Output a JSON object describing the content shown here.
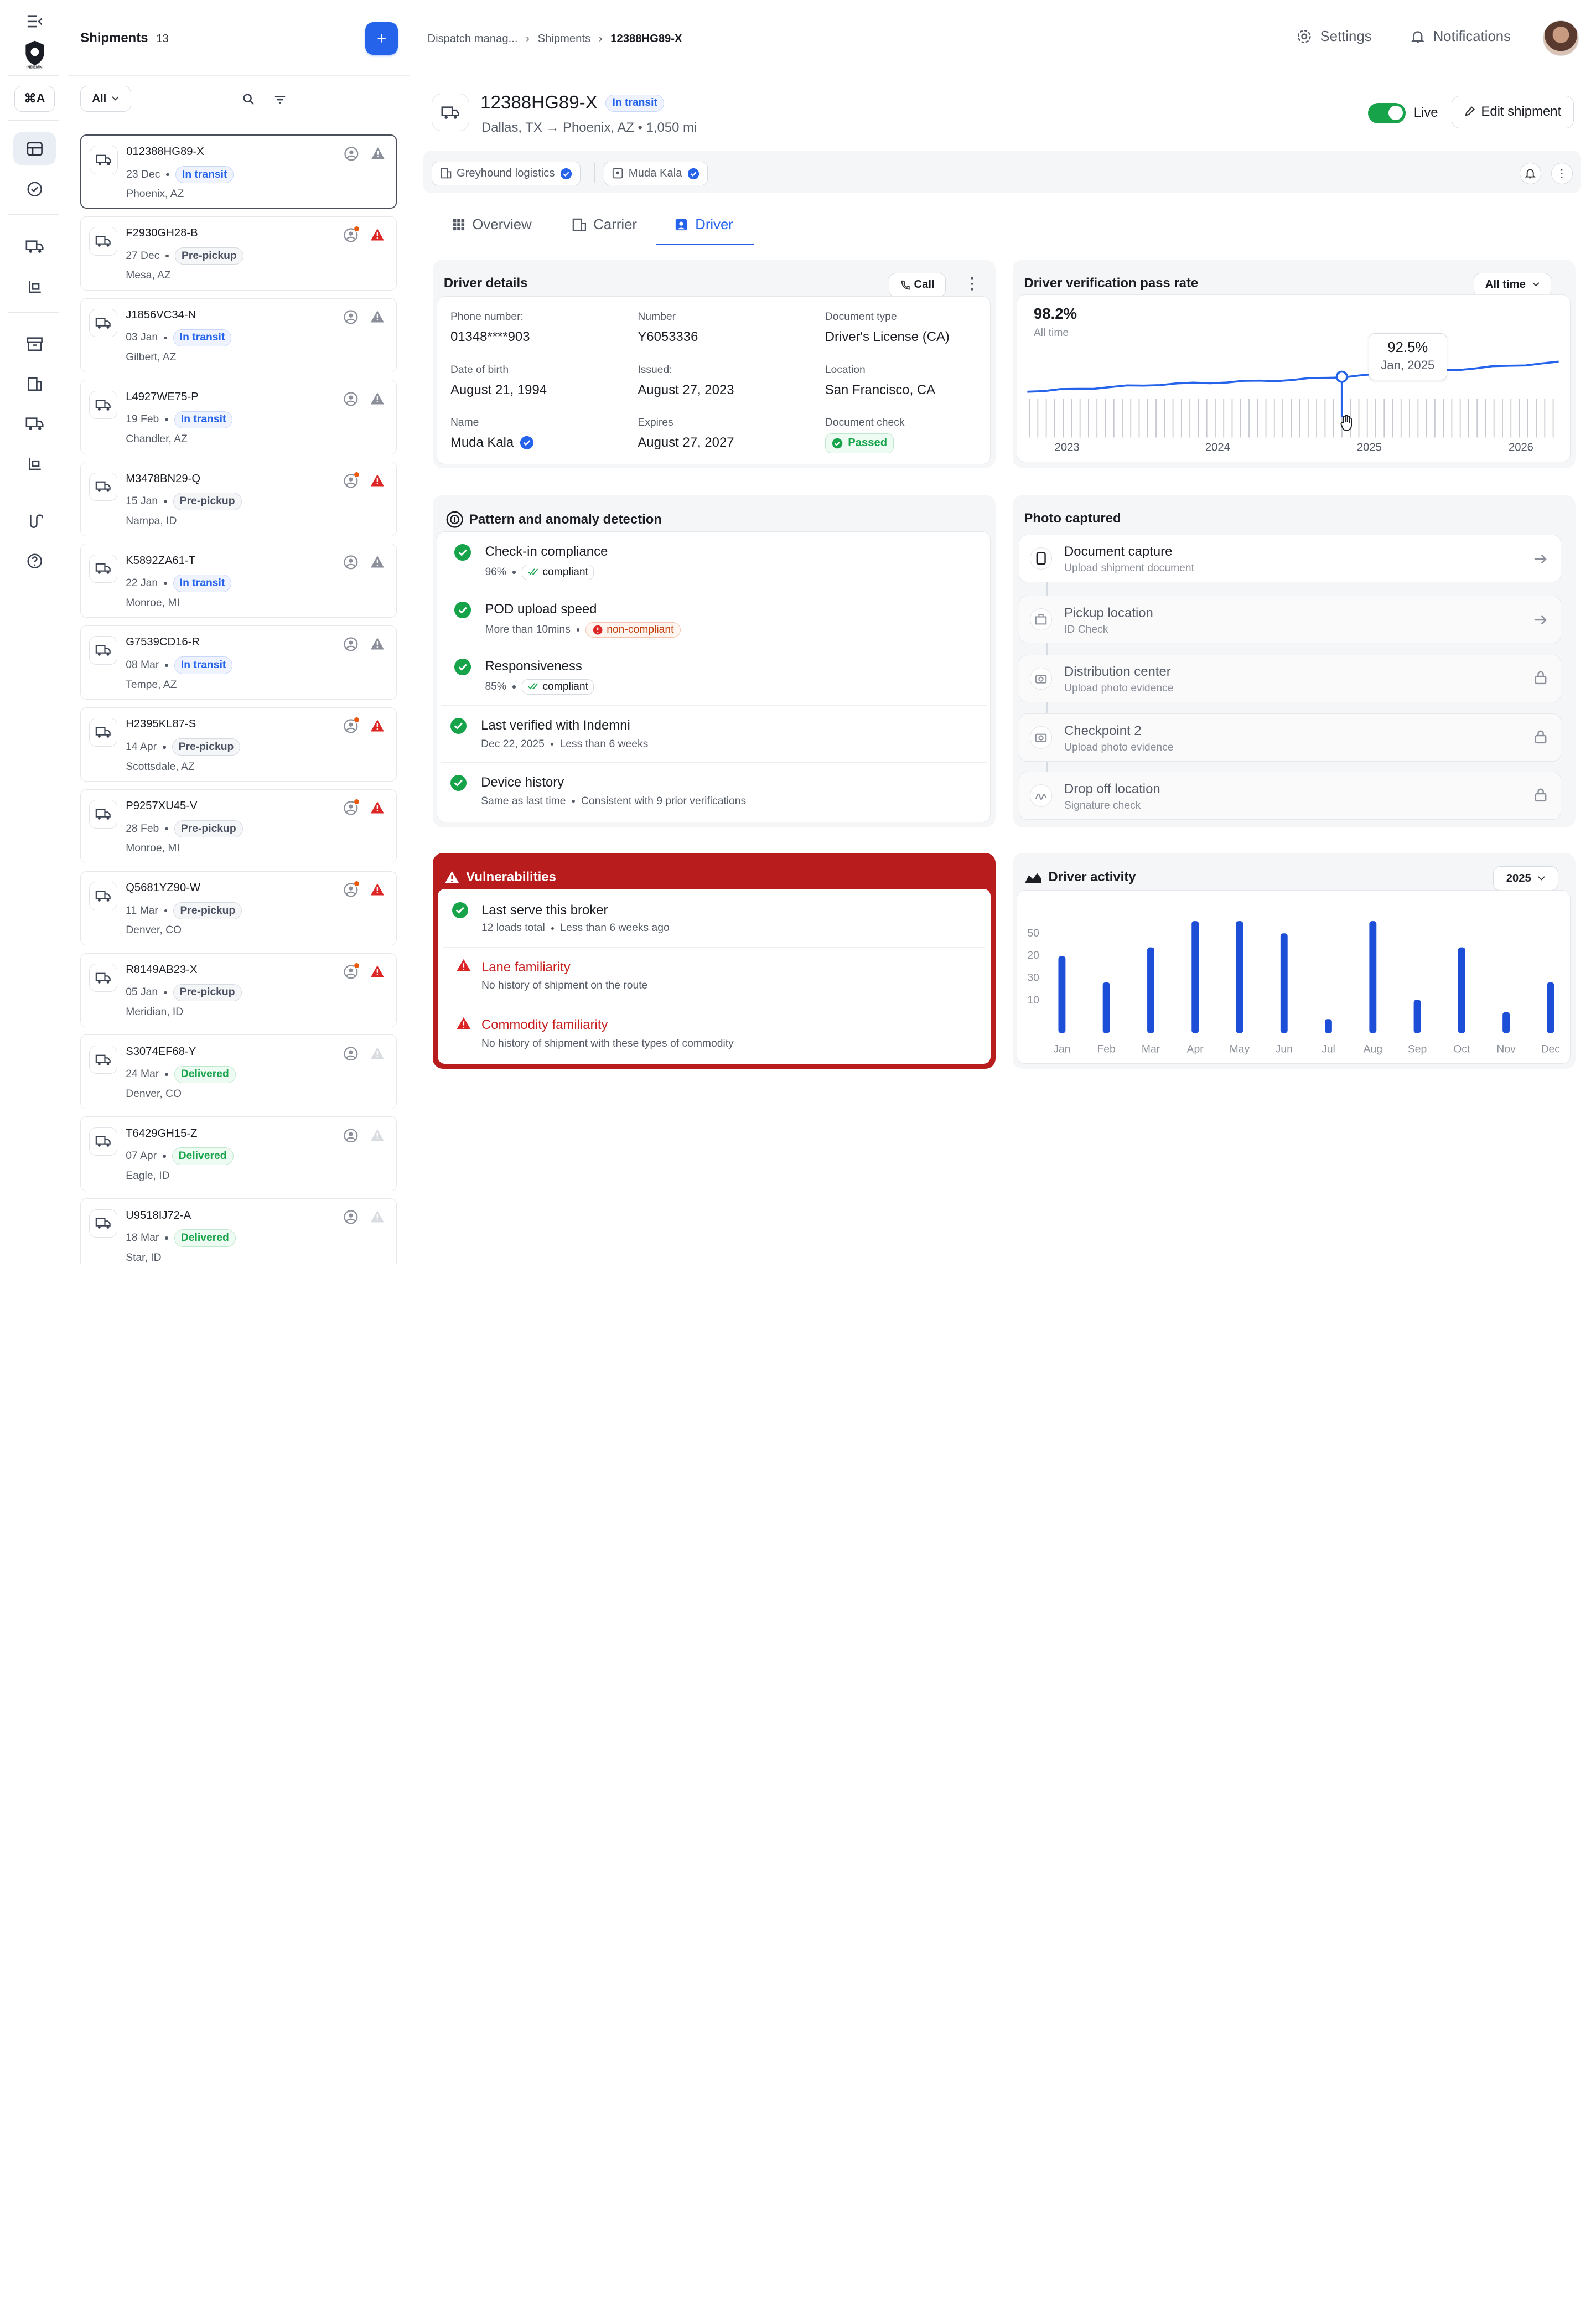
{
  "brand": {
    "logo_text": "INDEMNI"
  },
  "sidebar": {
    "cmdk_label": "⌘A"
  },
  "shipments": {
    "title": "Shipments",
    "count": "13",
    "filter_label": "All",
    "items": [
      {
        "id": "012388HG89-X",
        "date": "23 Dec",
        "status": "In transit",
        "location": "Phoenix, AZ",
        "alert": false,
        "warn": "gray"
      },
      {
        "id": "F2930GH28-B",
        "date": "27 Dec",
        "status": "Pre-pickup",
        "location": "Mesa, AZ",
        "alert": true,
        "warn": "red"
      },
      {
        "id": "J1856VC34-N",
        "date": "03 Jan",
        "status": "In transit",
        "location": "Gilbert, AZ",
        "alert": false,
        "warn": "gray"
      },
      {
        "id": "L4927WE75-P",
        "date": "19 Feb",
        "status": "In transit",
        "location": "Chandler, AZ",
        "alert": false,
        "warn": "gray"
      },
      {
        "id": "M3478BN29-Q",
        "date": "15 Jan",
        "status": "Pre-pickup",
        "location": "Nampa, ID",
        "alert": true,
        "warn": "red"
      },
      {
        "id": "K5892ZA61-T",
        "date": "22 Jan",
        "status": "In transit",
        "location": "Monroe, MI",
        "alert": false,
        "warn": "gray"
      },
      {
        "id": "G7539CD16-R",
        "date": "08 Mar",
        "status": "In transit",
        "location": "Tempe, AZ",
        "alert": false,
        "warn": "gray"
      },
      {
        "id": "H2395KL87-S",
        "date": "14 Apr",
        "status": "Pre-pickup",
        "location": "Scottsdale, AZ",
        "alert": true,
        "warn": "red"
      },
      {
        "id": "P9257XU45-V",
        "date": "28 Feb",
        "status": "Pre-pickup",
        "location": "Monroe, MI",
        "alert": true,
        "warn": "red"
      },
      {
        "id": "Q5681YZ90-W",
        "date": "11 Mar",
        "status": "Pre-pickup",
        "location": "Denver, CO",
        "alert": true,
        "warn": "red"
      },
      {
        "id": "R8149AB23-X",
        "date": "05 Jan",
        "status": "Pre-pickup",
        "location": "Meridian, ID",
        "alert": true,
        "warn": "red"
      },
      {
        "id": "S3074EF68-Y",
        "date": "24 Mar",
        "status": "Delivered",
        "location": "Denver, CO",
        "alert": false,
        "warn": "light"
      },
      {
        "id": "T6429GH15-Z",
        "date": "07 Apr",
        "status": "Delivered",
        "location": "Eagle, ID",
        "alert": false,
        "warn": "light"
      },
      {
        "id": "U9518IJ72-A",
        "date": "18 Mar",
        "status": "Delivered",
        "location": "Star, ID",
        "alert": false,
        "warn": "light"
      }
    ]
  },
  "topbar": {
    "breadcrumb": [
      "Dispatch manag...",
      "Shipments",
      "12388HG89-X"
    ],
    "settings_label": "Settings",
    "notifications_label": "Notifications"
  },
  "shipment": {
    "id": "12388HG89-X",
    "status": "In transit",
    "route": "Dallas, TX → Phoenix, AZ • 1,050 mi",
    "live_label": "Live",
    "edit_label": "Edit shipment",
    "carrier_chip": "Greyhound logistics",
    "driver_chip": "Muda Kala"
  },
  "tabs": [
    {
      "label": "Overview",
      "icon": "grid-icon"
    },
    {
      "label": "Carrier",
      "icon": "building-icon"
    },
    {
      "label": "Driver",
      "icon": "id-badge-icon"
    }
  ],
  "driver_details": {
    "title": "Driver details",
    "call_label": "Call",
    "phone_label": "Phone number:",
    "phone": "01348****903",
    "number_label": "Number",
    "number": "Y6053336",
    "doctype_label": "Document type",
    "doctype": "Driver's License (CA)",
    "dob_label": "Date of birth",
    "dob": "August 21, 1994",
    "issued_label": "Issued:",
    "issued": "August 27, 2023",
    "location_label": "Location",
    "location": "San Francisco, CA",
    "name_label": "Name",
    "name": "Muda Kala",
    "expires_label": "Expires",
    "expires": "August 27, 2027",
    "doccheck_label": "Document check",
    "doccheck": "Passed"
  },
  "verification": {
    "title": "Driver verification pass rate",
    "range_label": "All time",
    "value": "98.2%",
    "value_sub": "All time",
    "tooltip_value": "92.5%",
    "tooltip_date": "Jan, 2025",
    "years": [
      "2023",
      "2024",
      "2025",
      "2026"
    ]
  },
  "pattern": {
    "title": "Pattern and anomaly detection",
    "items": [
      {
        "title": "Check-in compliance",
        "meta": "96%",
        "tag": "compliant"
      },
      {
        "title": "POD upload speed",
        "meta": "More than 10mins",
        "tag": "non-compliant"
      },
      {
        "title": "Responsiveness",
        "meta": "85%",
        "tag": "compliant"
      },
      {
        "title": "Last verified with Indemni",
        "meta": "Dec 22, 2025",
        "meta2": "Less than 6 weeks"
      },
      {
        "title": "Device history",
        "meta": "Same as last time",
        "meta2": "Consistent with 9 prior verifications"
      }
    ]
  },
  "photos": {
    "title": "Photo captured",
    "items": [
      {
        "title": "Document capture",
        "sub": "Upload shipment document",
        "icon": "phone-icon",
        "end": "arrow-right-icon"
      },
      {
        "title": "Pickup location",
        "sub": "ID Check",
        "icon": "building-icon",
        "end": "arrow-right-icon"
      },
      {
        "title": "Distribution center",
        "sub": "Upload photo evidence",
        "icon": "camera-icon",
        "end": "lock-icon"
      },
      {
        "title": "Checkpoint 2",
        "sub": "Upload photo evidence",
        "icon": "camera-icon",
        "end": "lock-icon"
      },
      {
        "title": "Drop off location",
        "sub": "Signature check",
        "icon": "signature-icon",
        "end": "lock-icon"
      }
    ]
  },
  "vulnerabilities": {
    "title": "Vulnerabilities",
    "items": [
      {
        "title": "Last serve this broker",
        "meta": "12 loads total",
        "meta2": "Less than 6 weeks ago",
        "ok": true
      },
      {
        "title": "Lane familiarity",
        "meta": "No history of shipment on the route",
        "ok": false
      },
      {
        "title": "Commodity familiarity",
        "meta": "No history of shipment with these types of commodity",
        "ok": false
      }
    ]
  },
  "activity": {
    "title": "Driver activity",
    "year_label": "2025"
  },
  "colors": {
    "accent": "#2563eb",
    "danger": "#b91c1c",
    "success": "#16a34a"
  },
  "chart_data": [
    {
      "type": "line",
      "title": "Driver verification pass rate",
      "x": [
        "2023",
        "2024",
        "2025",
        "2026"
      ],
      "series": [
        {
          "values": [
            95.0,
            95.8,
            96.3,
            97.2,
            98.2
          ]
        }
      ],
      "highlight": {
        "label": "Jan, 2025",
        "value": 92.5
      }
    },
    {
      "type": "bar",
      "title": "Driver activity",
      "categories": [
        "Jan",
        "Feb",
        "Mar",
        "Apr",
        "May",
        "Jun",
        "Jul",
        "Aug",
        "Sep",
        "Oct",
        "Nov",
        "Dec"
      ],
      "y_ticks": [
        "50",
        "20",
        "30",
        "10"
      ],
      "series": [
        {
          "values": [
            44,
            29,
            49,
            64,
            64,
            57,
            8,
            64,
            19,
            49,
            12,
            29
          ]
        }
      ]
    }
  ]
}
